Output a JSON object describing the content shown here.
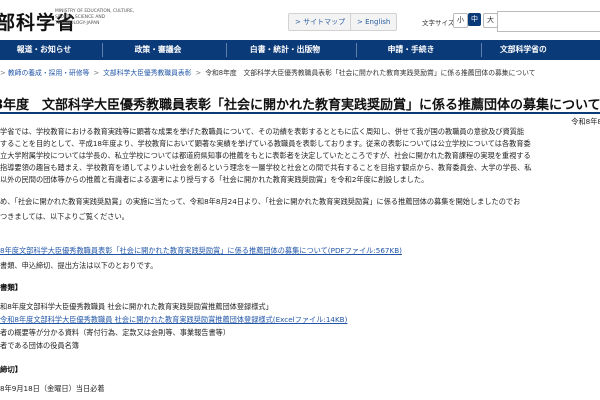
{
  "header": {
    "logo_text": "部科学省",
    "logo_en": "MINISTRY OF EDUCATION, CULTURE, SPORTS, SCIENCE AND TECHNOLOGY-JAPAN",
    "sitemap_label": "> サイトマップ",
    "english_label": "> English",
    "font_size_label": "文字サイズの変更",
    "font_size_small": "小",
    "font_size_medium": "中",
    "font_size_large": "大"
  },
  "nav": {
    "items": [
      "報道・お知らせ",
      "政策・審議会",
      "白書・統計・出版物",
      "申請・手続き",
      "文部科学省の"
    ]
  },
  "breadcrumbs": {
    "items": [
      "教師の養成・採用・研修等",
      "文部科学大臣優秀教職員表彰"
    ],
    "current": "令和8年度　文部科学大臣優秀教職員表彰「社会に開かれた教育実践奨励賞」に係る推薦団体の募集について"
  },
  "page": {
    "title": "8年度　文部科学大臣優秀教職員表彰「社会に開かれた教育実践奨励賞」に係る推薦団体の募集について",
    "date": "令和8年8",
    "intro": [
      "学省では、学校教育における教育実践等に顕著な成果を挙げた教職員について、その功績を表彰するとともに広く周知し、併せて我が国の教職員の意欲及び資質能",
      "することを目的として、平成18年度より、学校教育において顕著な実績を挙げている教職員を表彰しております。従来の表彰については公立学校については各教育委",
      "立大学附属学校については学長の、私立学校については都道府県知事の推薦をもとに表彰者を決定していたところですが、社会に開かれた教育課程の実現を重視する",
      "指導要領の趣旨も踏まえ、学校教育を通してよりよい社会を創るという理念を一層学校と社会との間で共有することを目指す観点から、教育委員会、大学の学長、私",
      "以外の民間の団体等からの推薦と有識者による選考により授与する「社会に開かれた教育実践奨励賞」を令和2年度に創設しました。"
    ],
    "para2": "め、「社会に開かれた教育実践奨励賞」の実施に当たって、令和8年8月24日より、「社会に開かれた教育実践奨励賞」に係る推薦団体の募集を開始しましたのでお",
    "para3": "つきましては、以下よりご覧ください。",
    "link_main": "8年度文部科学大臣優秀教職員表彰「社会に開かれた教育実践奨励賞」に係る推薦団体の募集について(PDFファイル:567KB)",
    "para4": "書類、申込締切、提出方法は以下のとおりです。",
    "docs_heading": "書類】",
    "docs_items": [
      "和8年度文部科学大臣優秀教職員 社会に開かれた教育実践奨励賞推薦団体登録様式」",
      "令和8年度文部科学大臣優秀教職員 社会に開かれた教育実践奨励賞推薦団体登録様式(Excelファイル:14KB)",
      "者の概要等が分かる資料（寄付行為、定款又は会則等、事業報告書等）",
      "者である団体の役員名簿"
    ],
    "deadline_heading": "締切】",
    "deadline_text": "8年9月18日（金曜日）当日必着"
  }
}
